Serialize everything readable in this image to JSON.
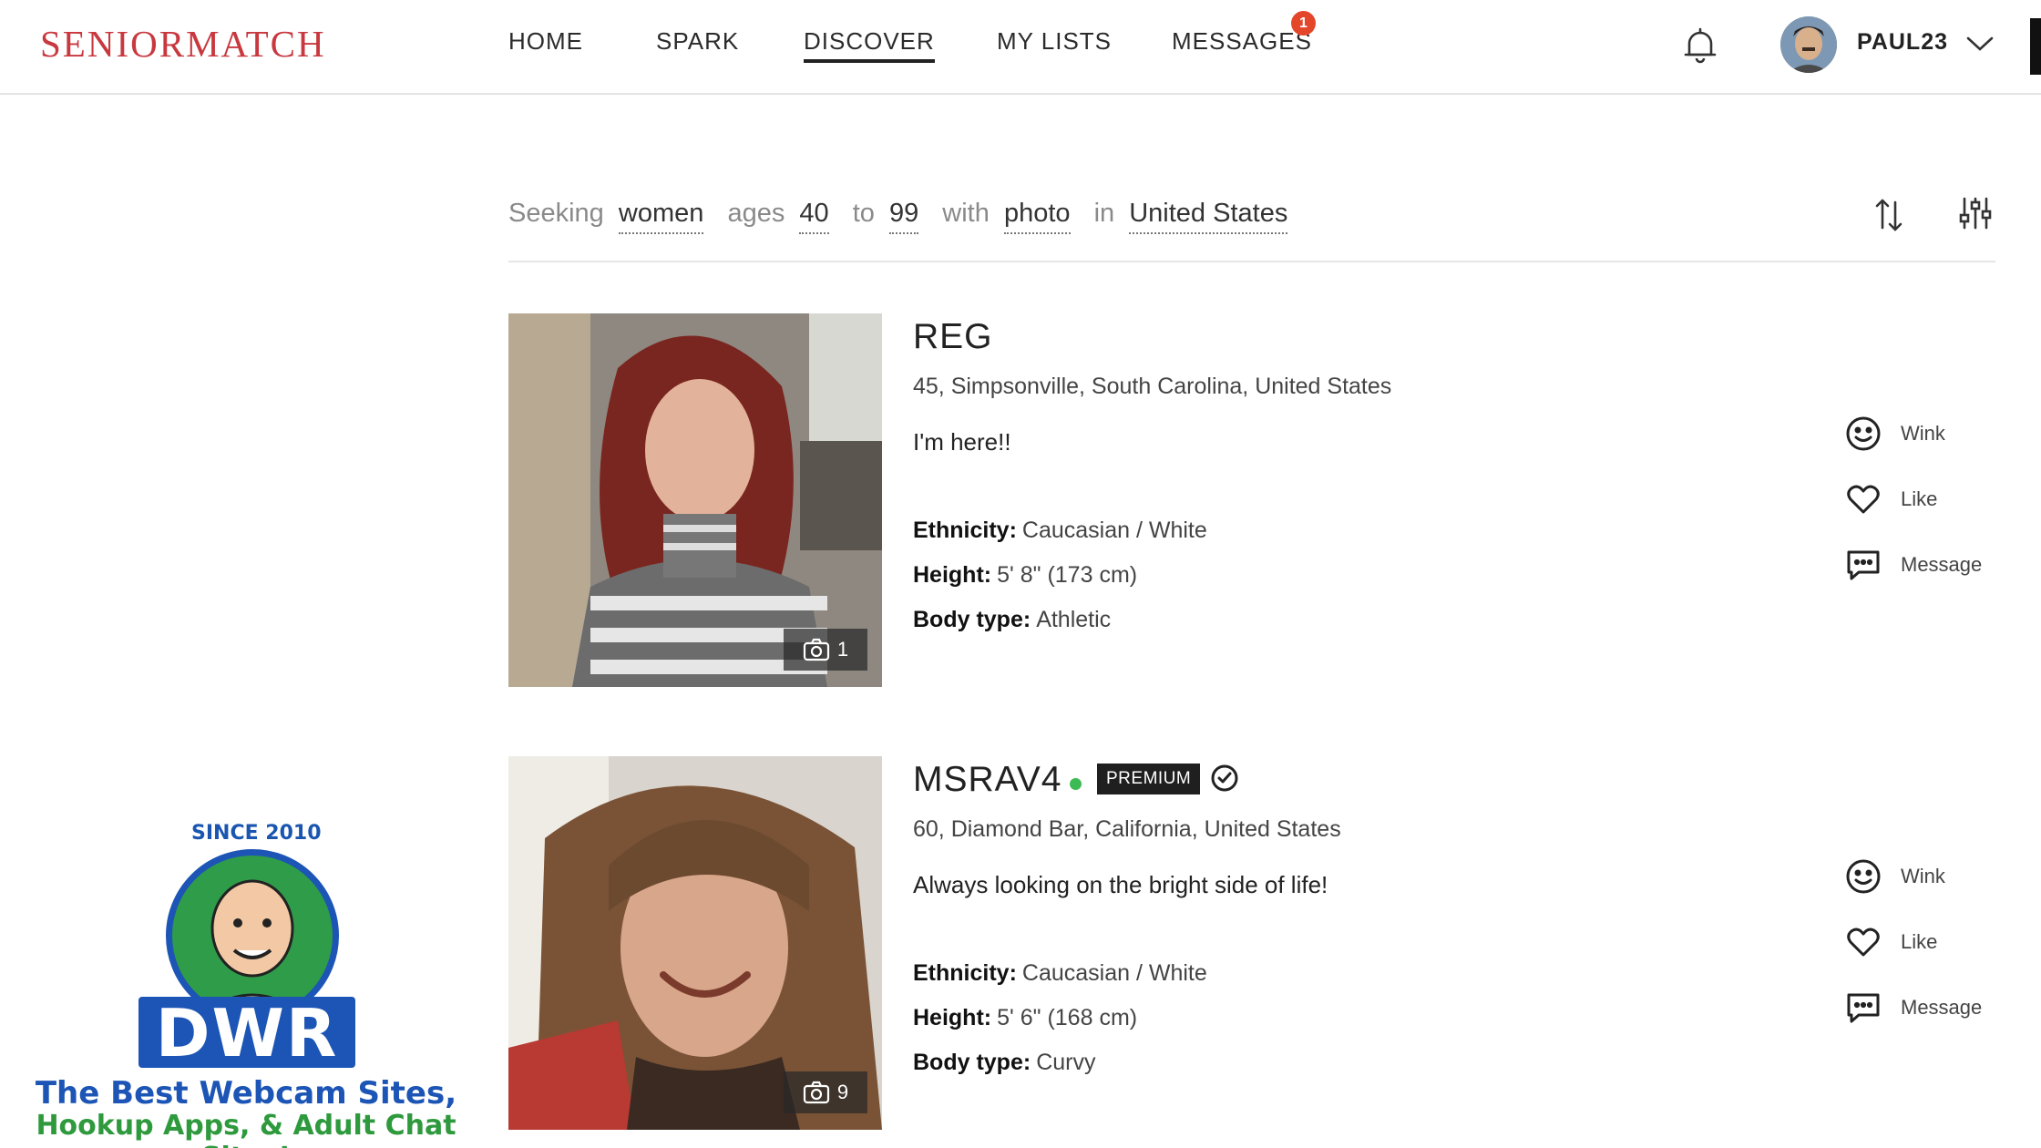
{
  "header": {
    "logo": "SENIORMATCH",
    "nav": [
      "HOME",
      "SPARK",
      "DISCOVER",
      "MY LISTS",
      "MESSAGES"
    ],
    "active_nav": "DISCOVER",
    "messages_badge": "1",
    "username": "PAUL23"
  },
  "search": {
    "seeking_label": "Seeking",
    "seeking_value": "women",
    "ages_label": "ages",
    "age_min": "40",
    "to_label": "to",
    "age_max": "99",
    "with_label": "with",
    "photo_value": "photo",
    "in_label": "in",
    "location_value": "United States"
  },
  "profiles": [
    {
      "name": "REG",
      "online": false,
      "premium": false,
      "verified": false,
      "location": "45, Simpsonville, South Carolina, United States",
      "tagline": "I'm here!!",
      "ethnicity_label": "Ethnicity:",
      "ethnicity": "Caucasian / White",
      "height_label": "Height:",
      "height": "5' 8\" (173 cm)",
      "body_label": "Body type:",
      "body": "Athletic",
      "photo_count": "1"
    },
    {
      "name": "MSRAV4",
      "online": true,
      "premium": true,
      "premium_label": "PREMIUM",
      "verified": true,
      "location": "60, Diamond Bar, California, United States",
      "tagline": "Always looking on the bright side of life!",
      "ethnicity_label": "Ethnicity:",
      "ethnicity": "Caucasian / White",
      "height_label": "Height:",
      "height": "5' 6\" (168 cm)",
      "body_label": "Body type:",
      "body": "Curvy",
      "photo_count": "9"
    }
  ],
  "actions": {
    "wink": "Wink",
    "like": "Like",
    "message": "Message"
  },
  "watermark": {
    "since": "SINCE 2010",
    "brand": "DWR",
    "line1": "The Best Webcam Sites,",
    "line2": "Hookup Apps, & Adult Chat Sites!"
  },
  "colors": {
    "brand": "#c8383f",
    "badge": "#e4462a",
    "online": "#3cba54",
    "premium_bg": "#1f1f1f"
  }
}
